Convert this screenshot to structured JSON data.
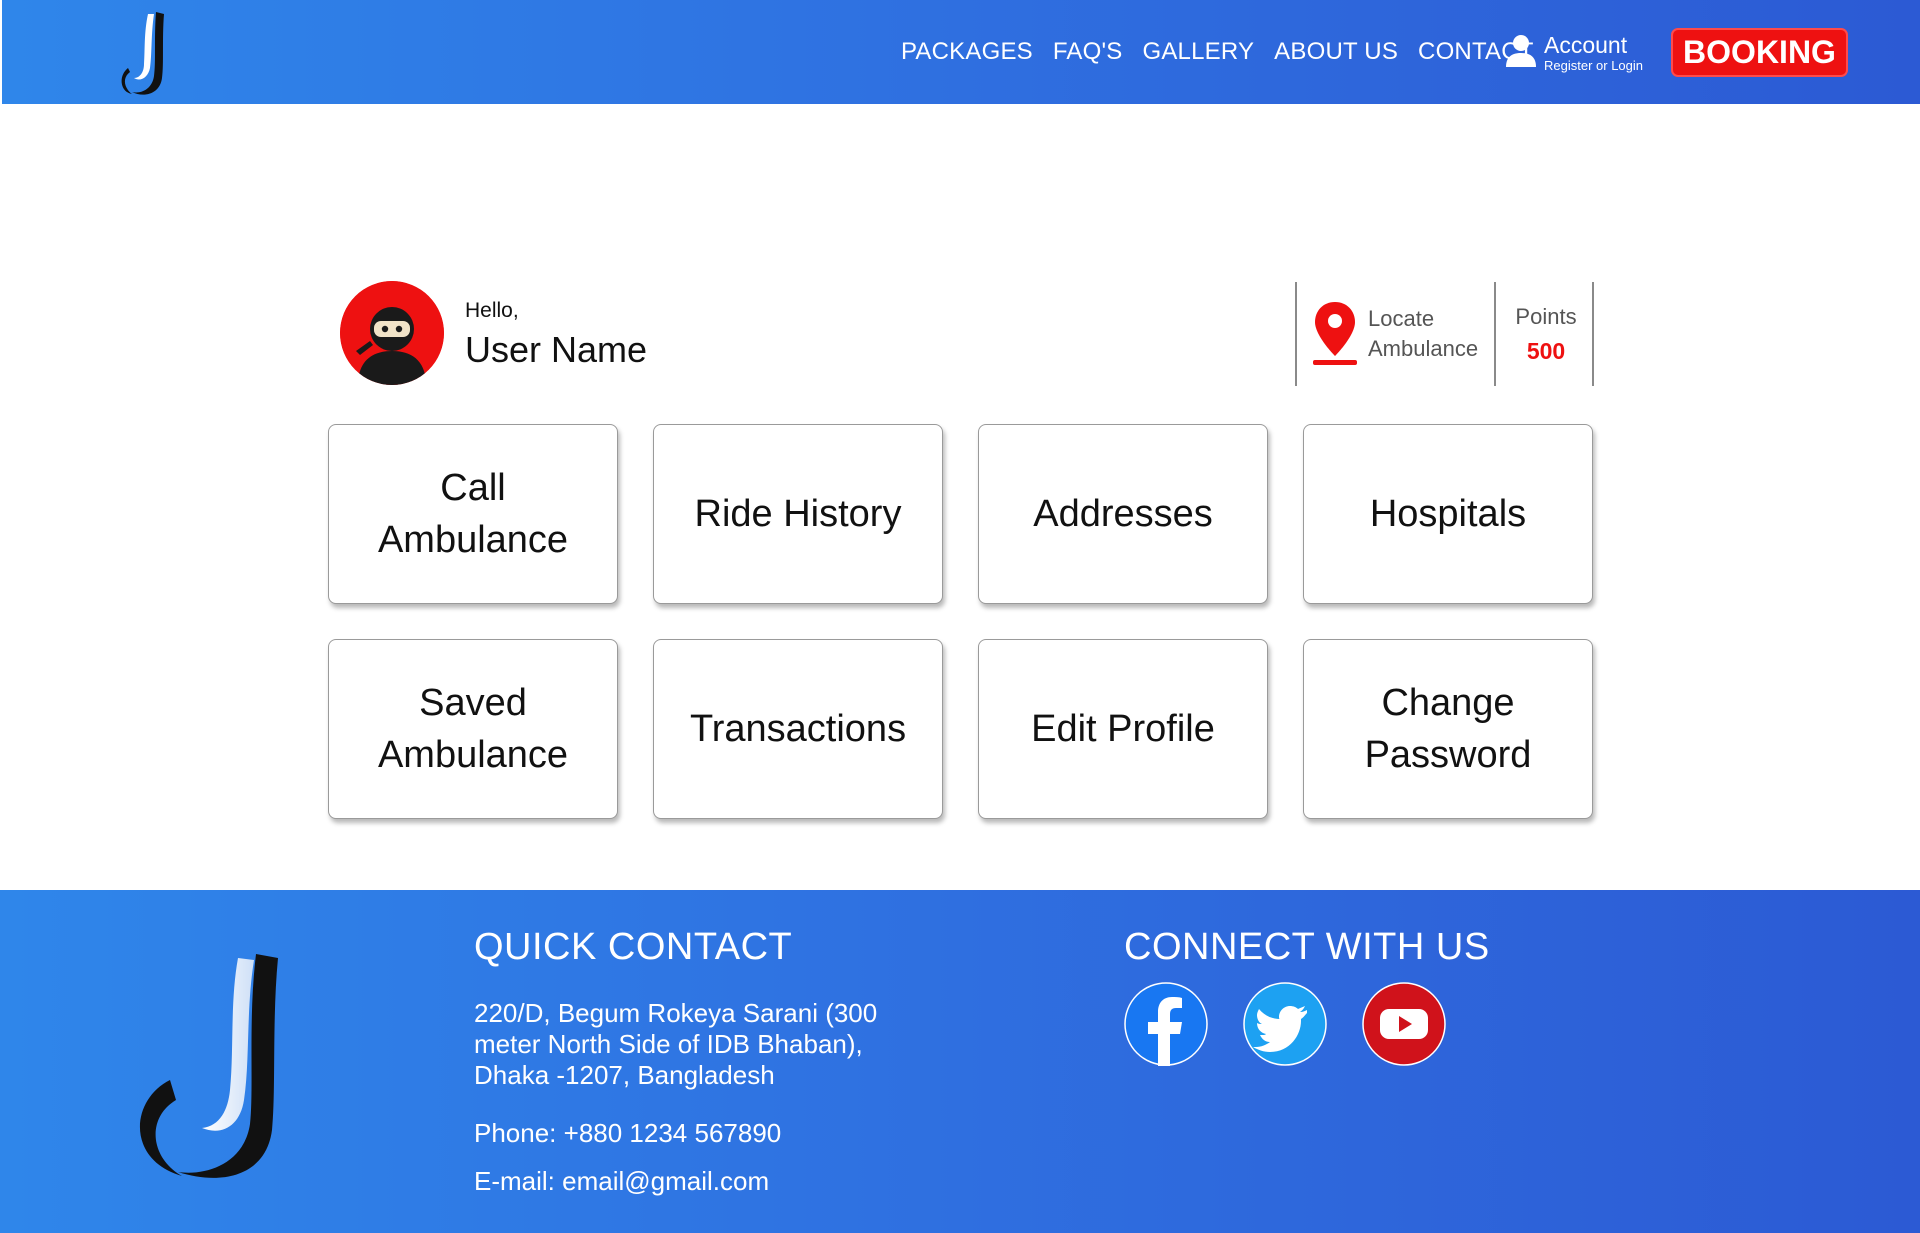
{
  "header": {
    "nav": [
      "PACKAGES",
      "FAQ'S",
      "GALLERY",
      "ABOUT US",
      "CONTACT"
    ],
    "account_title": "Account",
    "account_sub": "Register or Login",
    "booking_label": "BOOKING"
  },
  "profile": {
    "greeting": "Hello,",
    "username": "User Name",
    "locate_line1": "Locate",
    "locate_line2": "Ambulance",
    "points_label": "Points",
    "points_value": "500"
  },
  "tiles": [
    "Call Ambulance",
    "Ride History",
    "Addresses",
    "Hospitals",
    "Saved Ambulance",
    "Transactions",
    "Edit Profile",
    "Change Password"
  ],
  "footer": {
    "quick_contact_title": "QUICK CONTACT",
    "address": "220/D, Begum Rokeya Sarani (300 meter North Side of IDB Bhaban), Dhaka -1207, Bangladesh",
    "phone": "Phone: +880 1234 567890",
    "email": "E-mail: email@gmail.com",
    "connect_title": "CONNECT WITH US",
    "social": [
      "facebook-icon",
      "twitter-icon",
      "youtube-icon"
    ]
  },
  "colors": {
    "brand_blue": "#2f6fe0",
    "accent_red": "#ee1111",
    "facebook": "#1877f2",
    "twitter": "#1da1f2",
    "youtube": "#d0121b"
  }
}
